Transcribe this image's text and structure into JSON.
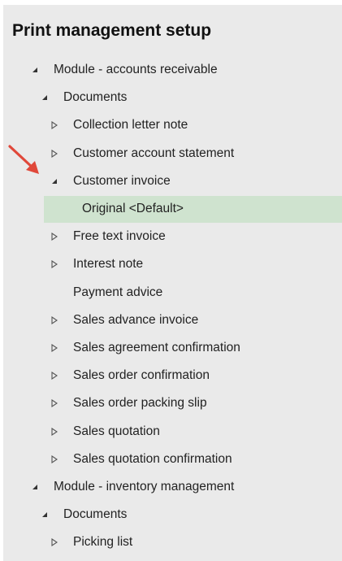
{
  "title": "Print management setup",
  "tree": [
    {
      "label": "Module - accounts receivable",
      "expander": "expanded",
      "level": 0
    },
    {
      "label": "Documents",
      "expander": "expanded",
      "level": 1
    },
    {
      "label": "Collection letter note",
      "expander": "collapsed",
      "level": 2
    },
    {
      "label": "Customer account statement",
      "expander": "collapsed",
      "level": 2
    },
    {
      "label": "Customer invoice",
      "expander": "expanded",
      "level": 2
    },
    {
      "label": "Original <Default>",
      "expander": "none",
      "level": 3,
      "selected": true
    },
    {
      "label": "Free text invoice",
      "expander": "collapsed",
      "level": 2
    },
    {
      "label": "Interest note",
      "expander": "collapsed",
      "level": 2
    },
    {
      "label": "Payment advice",
      "expander": "none",
      "level": 2
    },
    {
      "label": "Sales advance invoice",
      "expander": "collapsed",
      "level": 2
    },
    {
      "label": "Sales agreement confirmation",
      "expander": "collapsed",
      "level": 2
    },
    {
      "label": "Sales order confirmation",
      "expander": "collapsed",
      "level": 2
    },
    {
      "label": "Sales order packing slip",
      "expander": "collapsed",
      "level": 2
    },
    {
      "label": "Sales quotation",
      "expander": "collapsed",
      "level": 2
    },
    {
      "label": "Sales quotation confirmation",
      "expander": "collapsed",
      "level": 2
    },
    {
      "label": "Module - inventory management",
      "expander": "expanded",
      "level": 0
    },
    {
      "label": "Documents",
      "expander": "expanded",
      "level": 1
    },
    {
      "label": "Picking list",
      "expander": "collapsed",
      "level": 2
    }
  ],
  "colors": {
    "panel": "#eaeaea",
    "selected_row": "#cfe3cf",
    "annotation_arrow": "#e0483a"
  },
  "annotation": {
    "icon": "red-arrow-icon",
    "points_to": "Customer invoice"
  }
}
